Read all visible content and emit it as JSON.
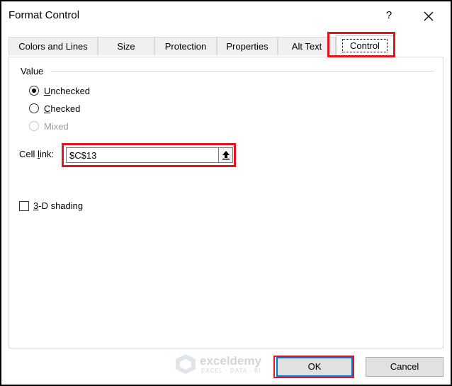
{
  "window": {
    "title": "Format Control",
    "help_label": "?"
  },
  "tabs": [
    {
      "label": "Colors and Lines"
    },
    {
      "label": "Size"
    },
    {
      "label": "Protection"
    },
    {
      "label": "Properties"
    },
    {
      "label": "Alt Text"
    },
    {
      "label": "Control",
      "active": true
    }
  ],
  "value_group": {
    "label": "Value",
    "options": [
      {
        "prefix": "",
        "accel": "U",
        "rest": "nchecked",
        "checked": true,
        "disabled": false
      },
      {
        "prefix": "",
        "accel": "C",
        "rest": "hecked",
        "checked": false,
        "disabled": false
      },
      {
        "prefix": "",
        "accel": "",
        "rest": "Mixed",
        "checked": false,
        "disabled": true
      }
    ]
  },
  "cell_link": {
    "label_prefix": "Cell ",
    "label_accel": "l",
    "label_rest": "ink:",
    "value": "$C$13"
  },
  "shading": {
    "accel": "3",
    "rest": "-D shading",
    "checked": false
  },
  "watermark": {
    "name": "exceldemy",
    "tagline": "EXCEL · DATA · BI"
  },
  "buttons": {
    "ok_label": "OK",
    "cancel_label": "Cancel"
  },
  "colors": {
    "highlight": "#e3141c",
    "focus_border": "#0078d7"
  }
}
